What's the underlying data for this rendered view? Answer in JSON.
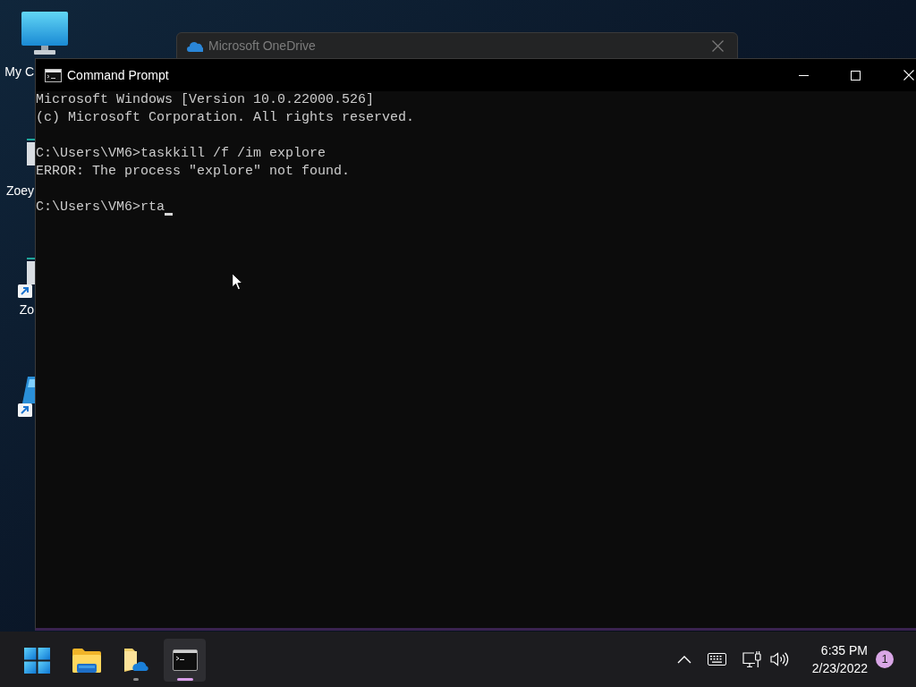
{
  "desktop_icons": [
    {
      "kind": "computer",
      "label": "My C",
      "shortcut": false
    },
    {
      "kind": "program",
      "label": "Zoey",
      "shortcut": false
    },
    {
      "kind": "program",
      "label": "Zo",
      "shortcut": true
    },
    {
      "kind": "tool",
      "shortcut": true
    }
  ],
  "background_window": {
    "title": "Microsoft OneDrive"
  },
  "window": {
    "title": "Command Prompt",
    "output": [
      {
        "lines": [
          "Microsoft Windows [Version 10.0.22000.526]",
          "(c) Microsoft Corporation. All rights reserved."
        ]
      },
      {
        "lines": [
          "C:\\Users\\VM6>taskkill /f /im explore",
          "ERROR: The process \"explore\" not found."
        ]
      }
    ],
    "prompt": "C:\\Users\\VM6>rta"
  },
  "taskbar": {
    "apps": [
      {
        "kind": "start",
        "running": false,
        "selected": false
      },
      {
        "kind": "folder",
        "running": false,
        "selected": false
      },
      {
        "kind": "cloud-folder",
        "running": true,
        "selected": false
      },
      {
        "kind": "terminal",
        "running": true,
        "selected": true
      }
    ],
    "clock": {
      "time": "6:35 PM",
      "date": "2/23/2022"
    },
    "notifications": "1"
  }
}
